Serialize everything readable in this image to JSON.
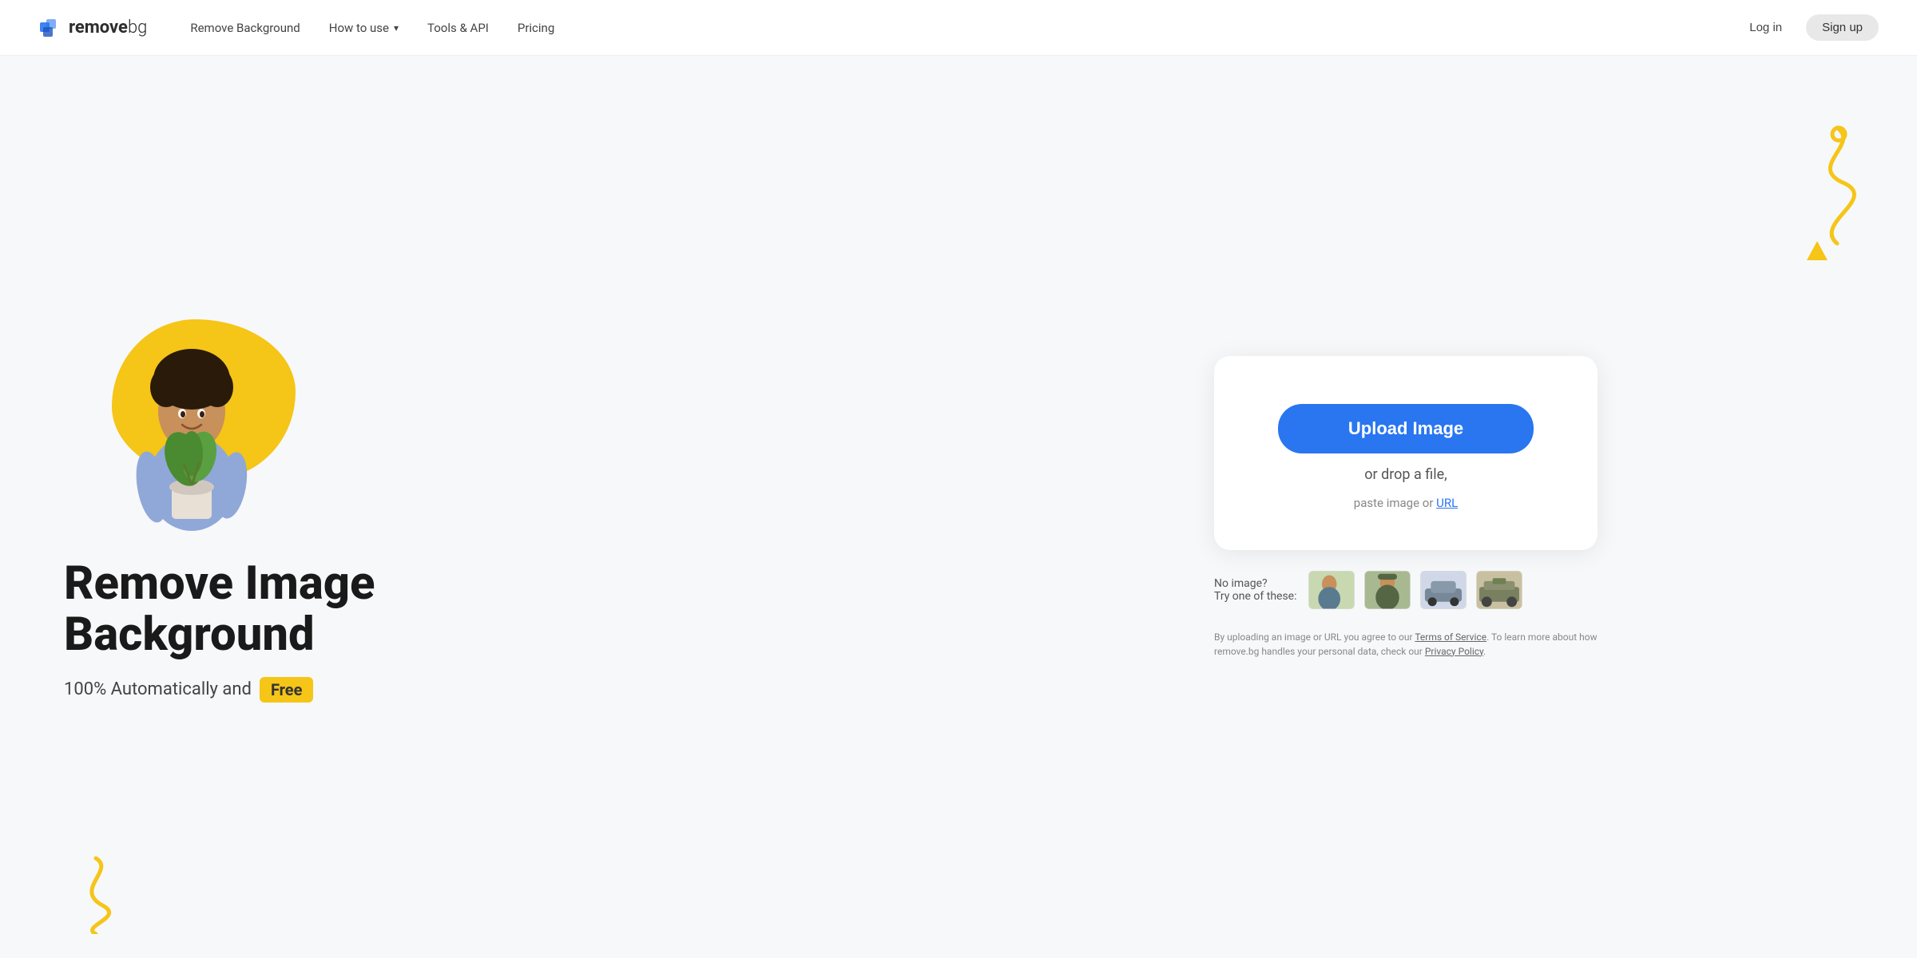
{
  "nav": {
    "logo_text_remove": "remove",
    "logo_text_bg": "bg",
    "links": [
      {
        "label": "Remove Background",
        "id": "remove-background",
        "has_dropdown": false
      },
      {
        "label": "How to use",
        "id": "how-to-use",
        "has_dropdown": true
      },
      {
        "label": "Tools & API",
        "id": "tools-api",
        "has_dropdown": false
      },
      {
        "label": "Pricing",
        "id": "pricing",
        "has_dropdown": false
      }
    ],
    "login_label": "Log in",
    "signup_label": "Sign up"
  },
  "hero": {
    "title_line1": "Remove Image",
    "title_line2": "Background",
    "subtitle_text": "100% Automatically and",
    "badge_text": "Free"
  },
  "upload": {
    "button_label": "Upload Image",
    "drop_text": "or drop a file,",
    "paste_text": "paste image or ",
    "url_link_text": "URL"
  },
  "samples": {
    "label_line1": "No image?",
    "label_line2": "Try one of these:",
    "images": [
      {
        "id": "sample-person",
        "alt": "Person sample"
      },
      {
        "id": "sample-soldier",
        "alt": "Soldier sample"
      },
      {
        "id": "sample-car",
        "alt": "Car sample"
      },
      {
        "id": "sample-vehicle",
        "alt": "Vehicle sample"
      }
    ]
  },
  "terms": {
    "text_before": "By uploading an image or URL you agree to our ",
    "tos_link": "Terms of Service",
    "text_middle": ". To learn more about how remove.bg handles your personal data, check our ",
    "privacy_link": "Privacy Policy",
    "text_end": "."
  },
  "colors": {
    "accent_blue": "#2976f0",
    "accent_yellow": "#f5c518",
    "bg": "#f7f8fa",
    "text_dark": "#1a1a1a"
  }
}
